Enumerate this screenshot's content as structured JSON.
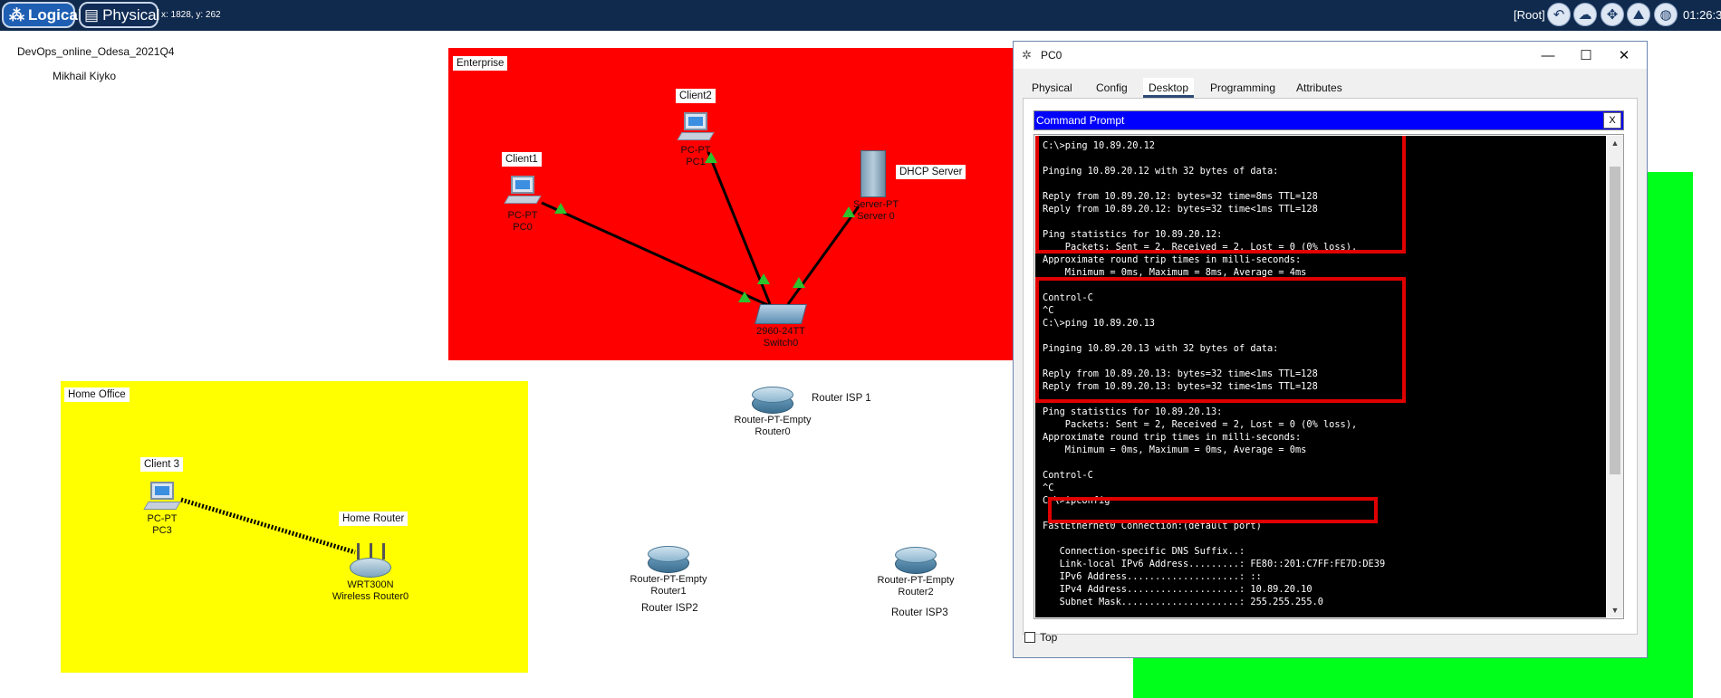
{
  "toolbar": {
    "logical_label": "Logical",
    "physical_label": "Physical",
    "coords": "x: 1828, y: 262",
    "root_label": "[Root]",
    "clock": "01:26:3",
    "icons": [
      "back-arrow-icon",
      "cloud-icon",
      "move-icon",
      "mountain-icon",
      "globe-icon"
    ]
  },
  "workspace": {
    "title": "DevOps_online_Odesa_2021Q4",
    "author": "Mikhail Kiyko",
    "areas": {
      "enterprise": {
        "label": "Enterprise",
        "color": "#ff0000"
      },
      "home_office": {
        "label": "Home Office",
        "color": "#ffff00"
      },
      "green": {
        "color": "#00ff1a"
      }
    },
    "notes": {
      "client1": "Client1",
      "client2": "Client2",
      "dhcp_server": "DHCP Server",
      "router_isp1": "Router ISP 1",
      "client3": "Client 3",
      "home_router": "Home Router",
      "router_isp2": "Router ISP2",
      "router_isp3": "Router ISP3"
    },
    "devices": {
      "pc0": {
        "model": "PC-PT",
        "name": "PC0"
      },
      "pc1": {
        "model": "PC-PT",
        "name": "PC1"
      },
      "server0": {
        "model": "Server-PT",
        "name": "Server 0"
      },
      "switch0": {
        "model": "2960-24TT",
        "name": "Switch0"
      },
      "router0": {
        "model": "Router-PT-Empty",
        "name": "Router0"
      },
      "router1": {
        "model": "Router-PT-Empty",
        "name": "Router1"
      },
      "router2": {
        "model": "Router-PT-Empty",
        "name": "Router2"
      },
      "pc3": {
        "model": "PC-PT",
        "name": "PC3"
      },
      "wrouter0": {
        "model": "WRT300N",
        "name": "Wireless Router0"
      }
    }
  },
  "window": {
    "title": "PC0",
    "controls": {
      "minimize": "—",
      "maximize": "☐",
      "close": "✕"
    },
    "tabs": [
      "Physical",
      "Config",
      "Desktop",
      "Programming",
      "Attributes"
    ],
    "active_tab": "Desktop",
    "cmd_title": "Command Prompt",
    "cmd_close": "X",
    "console_lines": [
      "C:\\>ping 10.89.20.12",
      "",
      "Pinging 10.89.20.12 with 32 bytes of data:",
      "",
      "Reply from 10.89.20.12: bytes=32 time=8ms TTL=128",
      "Reply from 10.89.20.12: bytes=32 time<1ms TTL=128",
      "",
      "Ping statistics for 10.89.20.12:",
      "    Packets: Sent = 2, Received = 2, Lost = 0 (0% loss),",
      "Approximate round trip times in milli-seconds:",
      "    Minimum = 0ms, Maximum = 8ms, Average = 4ms",
      "",
      "Control-C",
      "^C",
      "C:\\>ping 10.89.20.13",
      "",
      "Pinging 10.89.20.13 with 32 bytes of data:",
      "",
      "Reply from 10.89.20.13: bytes=32 time<1ms TTL=128",
      "Reply from 10.89.20.13: bytes=32 time<1ms TTL=128",
      "",
      "Ping statistics for 10.89.20.13:",
      "    Packets: Sent = 2, Received = 2, Lost = 0 (0% loss),",
      "Approximate round trip times in milli-seconds:",
      "    Minimum = 0ms, Maximum = 0ms, Average = 0ms",
      "",
      "Control-C",
      "^C",
      "C:\\>ipconfig",
      "",
      "FastEthernet0 Connection:(default port)",
      "",
      "   Connection-specific DNS Suffix..:",
      "   Link-local IPv6 Address.........: FE80::201:C7FF:FE7D:DE39",
      "   IPv6 Address....................: ::",
      "   IPv4 Address....................: 10.89.20.10",
      "   Subnet Mask.....................: 255.255.255.0"
    ],
    "top_checkbox_label": "Top",
    "top_checked": false,
    "highlight_color": "#e00000"
  }
}
